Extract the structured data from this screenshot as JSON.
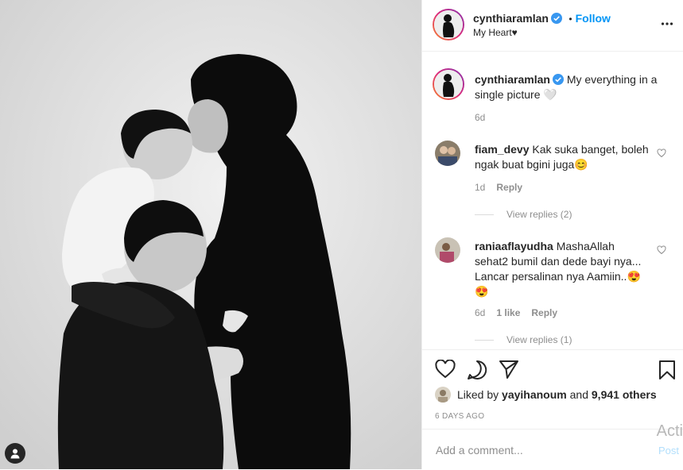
{
  "post": {
    "username": "cynthiaramlan",
    "follow_label": "Follow",
    "separator": "•",
    "location": "My Heart♥"
  },
  "caption": {
    "username": "cynthiaramlan",
    "text": "My everything in a single picture 🤍",
    "time": "6d"
  },
  "comments": [
    {
      "username": "fiam_devy",
      "text": "Kak suka banget, boleh ngak buat bgini juga😊",
      "time": "1d",
      "reply_label": "Reply",
      "view_replies": "View replies (2)"
    },
    {
      "username": "raniaaflayudha",
      "text": "MashaAllah sehat2 bumil dan dede bayi nya... Lancar persalinan nya Aamiin..😍😍",
      "time": "6d",
      "likes": "1 like",
      "reply_label": "Reply",
      "view_replies": "View replies (1)"
    }
  ],
  "likes": {
    "prefix": "Liked by",
    "user": "yayihanoum",
    "and": "and",
    "others": "9,941 others"
  },
  "time_ago": "6 DAYS AGO",
  "add_comment": {
    "placeholder": "Add a comment...",
    "post_label": "Post"
  },
  "watermark": "Acti",
  "colors": {
    "follow": "#0095f6",
    "verified": "#3897f0",
    "ring": "#dd2a7b"
  },
  "icons": [
    "heart-icon",
    "comment-icon",
    "share-icon",
    "save-icon",
    "more-icon",
    "user-tag-icon",
    "verified-icon"
  ]
}
